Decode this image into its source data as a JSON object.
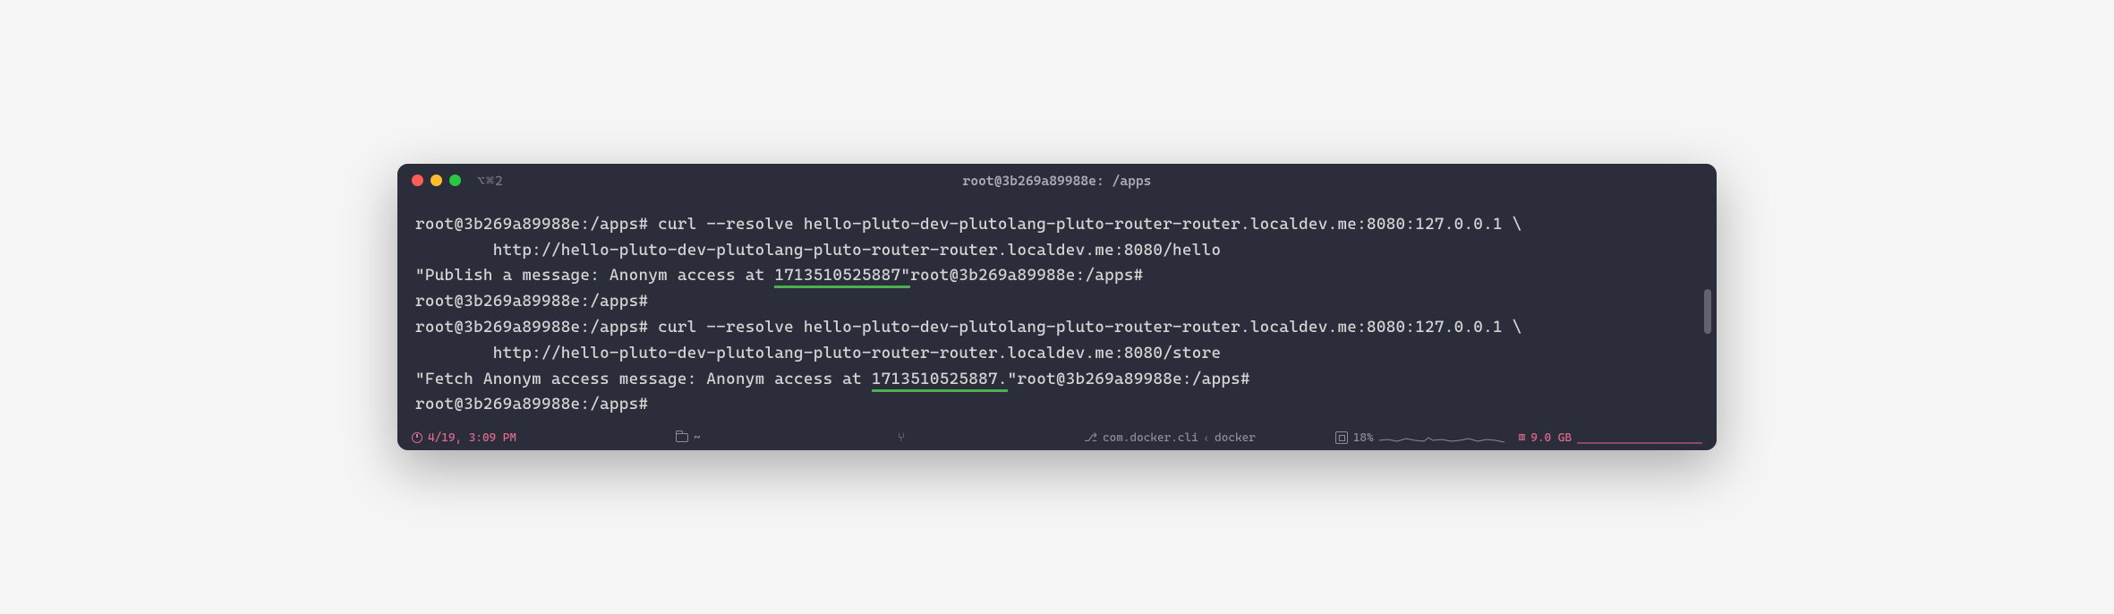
{
  "titlebar": {
    "tab_label": "⌥⌘2",
    "title": "root@3b269a89988e: /apps"
  },
  "terminal": {
    "prompt": "root@3b269a89988e:/apps#",
    "line1_cmd": " curl --resolve hello-pluto-dev-plutolang-pluto-router-router.localdev.me:8080:127.0.0.1 \\",
    "line2_cmd": "        http://hello-pluto-dev-plutolang-pluto-router-router.localdev.me:8080/hello",
    "line3_response_before": "\"Publish a message: Anonym access at ",
    "line3_highlight": "1713510525887\"",
    "line5_cmd": " curl --resolve hello-pluto-dev-plutolang-pluto-router-router.localdev.me:8080:127.0.0.1 \\",
    "line6_cmd": "        http://hello-pluto-dev-plutolang-pluto-router-router.localdev.me:8080/store",
    "line7_response_before": "\"Fetch Anonym access message: Anonym access at ",
    "line7_highlight": "1713510525887.",
    "line7_after": "\""
  },
  "statusbar": {
    "time": "4/19, 3:09 PM",
    "cwd": "~",
    "process_left": "com.docker.cli",
    "process_right": "docker",
    "cpu": "18%",
    "memory": "9.0 GB"
  }
}
